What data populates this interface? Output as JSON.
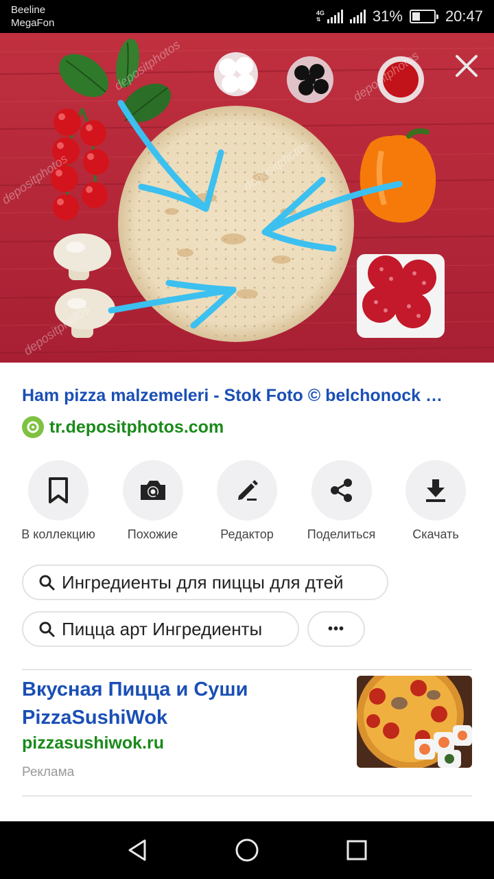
{
  "status": {
    "carrier1": "Beeline",
    "carrier2": "MegaFon",
    "network": "4G",
    "battery": "31%",
    "time": "20:47"
  },
  "photo": {
    "icon_close": "close-icon"
  },
  "result": {
    "title": "Ham pizza malzemeleri - Stok Foto © belchonock …",
    "source": "tr.depositphotos.com"
  },
  "actions": [
    {
      "label": "В коллекцию",
      "icon": "bookmark-icon"
    },
    {
      "label": "Похожие",
      "icon": "camera-search-icon"
    },
    {
      "label": "Редактор",
      "icon": "pencil-icon"
    },
    {
      "label": "Поделиться",
      "icon": "share-icon"
    },
    {
      "label": "Скачать",
      "icon": "download-icon"
    }
  ],
  "suggestions": [
    "Ингредиенты для пиццы для дтей",
    "Пицца арт Ингредиенты"
  ],
  "more_label": "•••",
  "ad": {
    "title": "Вкусная Пицца и Суши PizzaSushiWok",
    "domain": "pizzasushiwok.ru",
    "badge": "Реклама"
  },
  "colors": {
    "link_blue": "#1a4fb5",
    "domain_green": "#1a8a1a",
    "arrow_blue": "#3cc0f0",
    "wood_red": "#b8283a"
  }
}
